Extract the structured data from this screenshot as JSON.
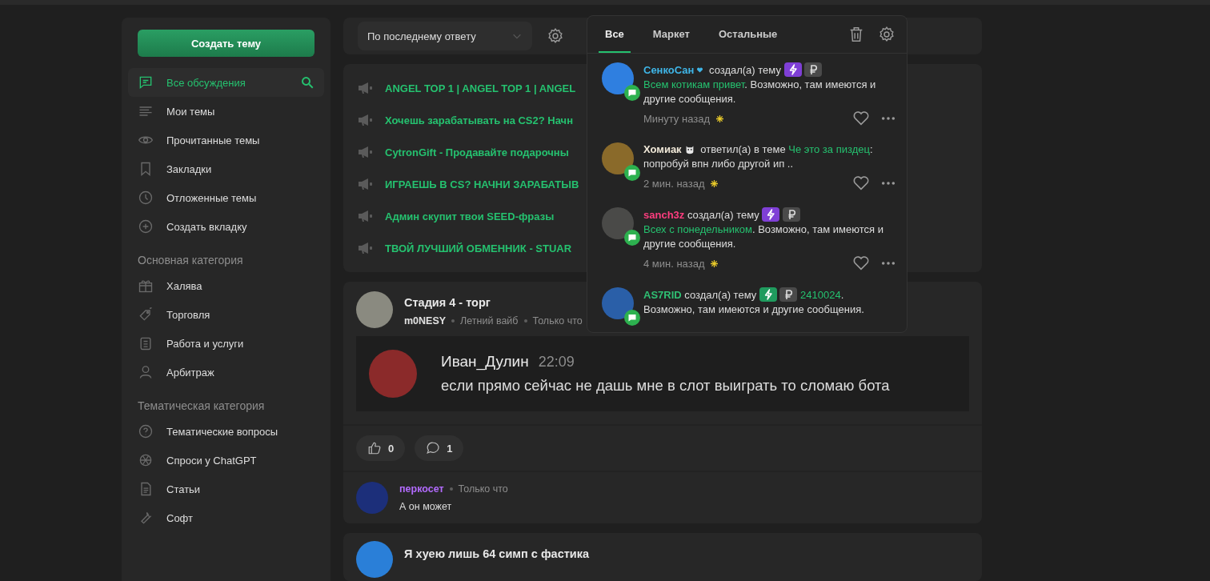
{
  "sidebar": {
    "create_button": "Создать тему",
    "nav": [
      {
        "label": "Все обсуждения",
        "selected": true
      },
      {
        "label": "Мои темы",
        "selected": false
      },
      {
        "label": "Прочитанные темы",
        "selected": false
      },
      {
        "label": "Закладки",
        "selected": false
      },
      {
        "label": "Отложенные темы",
        "selected": false
      },
      {
        "label": "Создать вкладку",
        "selected": false
      }
    ],
    "sections": [
      {
        "title": "Основная категория",
        "items": [
          {
            "label": "Халява"
          },
          {
            "label": "Торговля"
          },
          {
            "label": "Работа и услуги"
          },
          {
            "label": "Арбитраж"
          }
        ]
      },
      {
        "title": "Тематическая категория",
        "items": [
          {
            "label": "Тематические вопросы"
          },
          {
            "label": "Спроси у ChatGPT"
          },
          {
            "label": "Статьи"
          },
          {
            "label": "Софт"
          }
        ]
      }
    ]
  },
  "toolbar": {
    "sort": "По последнему ответу"
  },
  "pinned_threads": [
    {
      "title": "ANGEL TOP 1 | ANGEL TOP 1 | ANGEL"
    },
    {
      "title": "Хочешь зарабатывать на CS2? Начн"
    },
    {
      "title": "CytronGift - Продавайте подарочны"
    },
    {
      "title": "ИГРАЕШЬ В CS? НАЧНИ ЗАРАБАТЫВ"
    },
    {
      "title": "Админ скупит твои SEED-фразы"
    },
    {
      "title": "ТВОЙ ЛУЧШИЙ ОБМЕННИК - STUAR"
    }
  ],
  "post": {
    "title": "Стадия 4 - торг",
    "author": "m0NESY",
    "forum": "Летний вайб",
    "time": "Только что",
    "quote": {
      "author": "Иван_Дулин",
      "time": "22:09",
      "text": "если прямо сейчас не дашь мне в слот выиграть то сломаю бота"
    },
    "likes": "0",
    "comments": "1",
    "reply": {
      "author": "перкосет",
      "color": "#b36bff",
      "time": "Только что",
      "text": "А он может"
    }
  },
  "next_post": {
    "title": "Я хуею лишь 64 симп с фастика"
  },
  "notifications": {
    "tabs": [
      {
        "label": "Все",
        "selected": true
      },
      {
        "label": "Маркет",
        "selected": false
      },
      {
        "label": "Остальные",
        "selected": false
      }
    ],
    "items": [
      {
        "kind": "heart",
        "user": "СенкоСан",
        "color": "#3fb6e8",
        "action": "создал(а) тему",
        "prefixes": [
          {
            "kind": "lightning",
            "color": "#7f3fd6"
          },
          {
            "kind": "ruble"
          }
        ],
        "topic": "Всем котикам привет",
        "rest": ". Возможно, там имеются и другие сообщения.",
        "time": "Минуту назад"
      },
      {
        "kind": "animal",
        "user": "Хомиак",
        "color": "#f0e8d8",
        "action": "ответил(а) в теме",
        "topic": "Че это за пиздец",
        "rest": ": попробуй впн либо другой ип ..",
        "time": "2 мин. назад"
      },
      {
        "kind": "plain",
        "user": "sanch3z",
        "color": "#ff3d7f",
        "action": "создал(а) тему",
        "prefixes": [
          {
            "kind": "lightning",
            "color": "#7f3fd6"
          },
          {
            "kind": "ruble"
          }
        ],
        "topic": "Всех с понедельником",
        "rest": ". Возможно, там имеются и другие сообщения.",
        "time": "4 мин. назад"
      },
      {
        "kind": "plain",
        "user": "AS7RID",
        "color": "#2fbf73",
        "action": "создал(а) тему",
        "prefixes": [
          {
            "kind": "lightning",
            "color": "#1f9b5e"
          },
          {
            "kind": "ruble"
          }
        ],
        "topic": "2410024",
        "rest": ". Возможно, там имеются и другие сообщения."
      }
    ]
  }
}
